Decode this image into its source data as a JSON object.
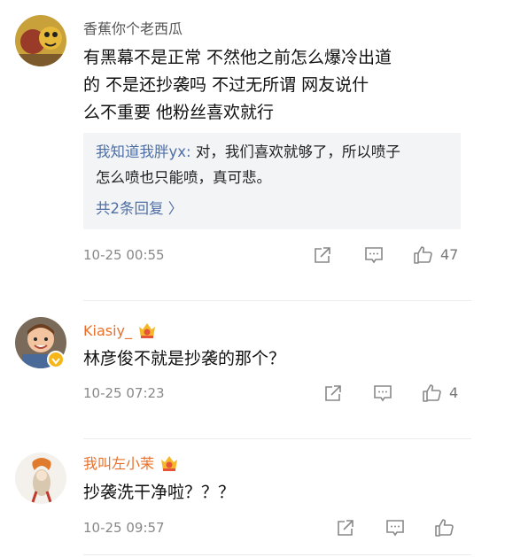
{
  "comments": [
    {
      "username": "香蕉你个老西瓜",
      "lines": [
        "有黑幕不是正常  不然他之前怎么爆冷出道",
        "的  不是还抄袭吗  不过无所谓  网友说什",
        "么不重要  他粉丝喜欢就行"
      ],
      "reply": {
        "user": "我知道我胖yx:",
        "line1": " 对，我们喜欢就够了，所以喷子",
        "line2": "怎么喷也只能喷，真可悲。",
        "more": "共2条回复 〉"
      },
      "time": "10-25 00:55",
      "likes": "47"
    },
    {
      "username": "Kiasiy_",
      "vip": true,
      "lines": [
        "林彦俊不就是抄袭的那个？"
      ],
      "time": "10-25 07:23",
      "likes": "4"
    },
    {
      "username": "我叫左小茉",
      "vip": true,
      "lines": [
        "抄袭洗干净啦？？？"
      ],
      "time": "10-25 09:57",
      "likes": ""
    }
  ],
  "icons": {
    "share": "share-icon",
    "reply": "comment-icon",
    "like": "thumbs-up-icon",
    "vip": "crown-badge-icon"
  },
  "colors": {
    "username_orange": "#e8702a",
    "reply_link": "#4e6fa6",
    "quote_bg": "#f3f4f6"
  }
}
